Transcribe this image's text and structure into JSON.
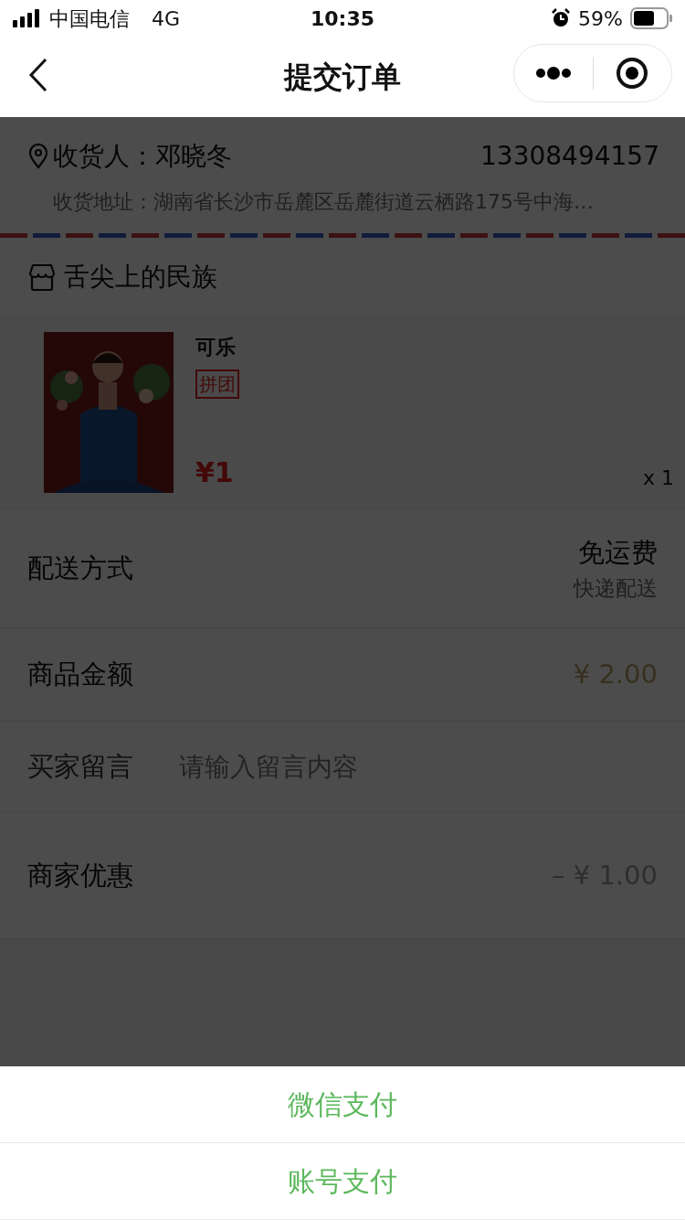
{
  "status_bar": {
    "carrier": "中国电信",
    "network": "4G",
    "time": "10:35",
    "battery": "59%"
  },
  "nav": {
    "title": "提交订单"
  },
  "address": {
    "recipient": "收货人：邓晓冬",
    "phone": "13308494157",
    "address": "收货地址：湖南省长沙市岳麓区岳麓街道云栖路175号中海…"
  },
  "shop": {
    "name": "舌尖上的民族"
  },
  "items": [
    {
      "name": "可乐",
      "tag": "拼团",
      "price": "¥1",
      "quantity": "x 1"
    }
  ],
  "rows": [
    {
      "kind": "shipping",
      "label": "配送方式",
      "value": "免运费",
      "note": "快递配送"
    },
    {
      "kind": "amount",
      "label": "商品金额",
      "value": "¥ 2.00"
    },
    {
      "kind": "message",
      "label": "买家留言",
      "placeholder": "请输入留言内容"
    },
    {
      "kind": "discount",
      "label": "商家优惠",
      "value": "– ¥ 1.00"
    }
  ],
  "action_sheet": {
    "options": [
      "微信支付",
      "账号支付"
    ]
  }
}
